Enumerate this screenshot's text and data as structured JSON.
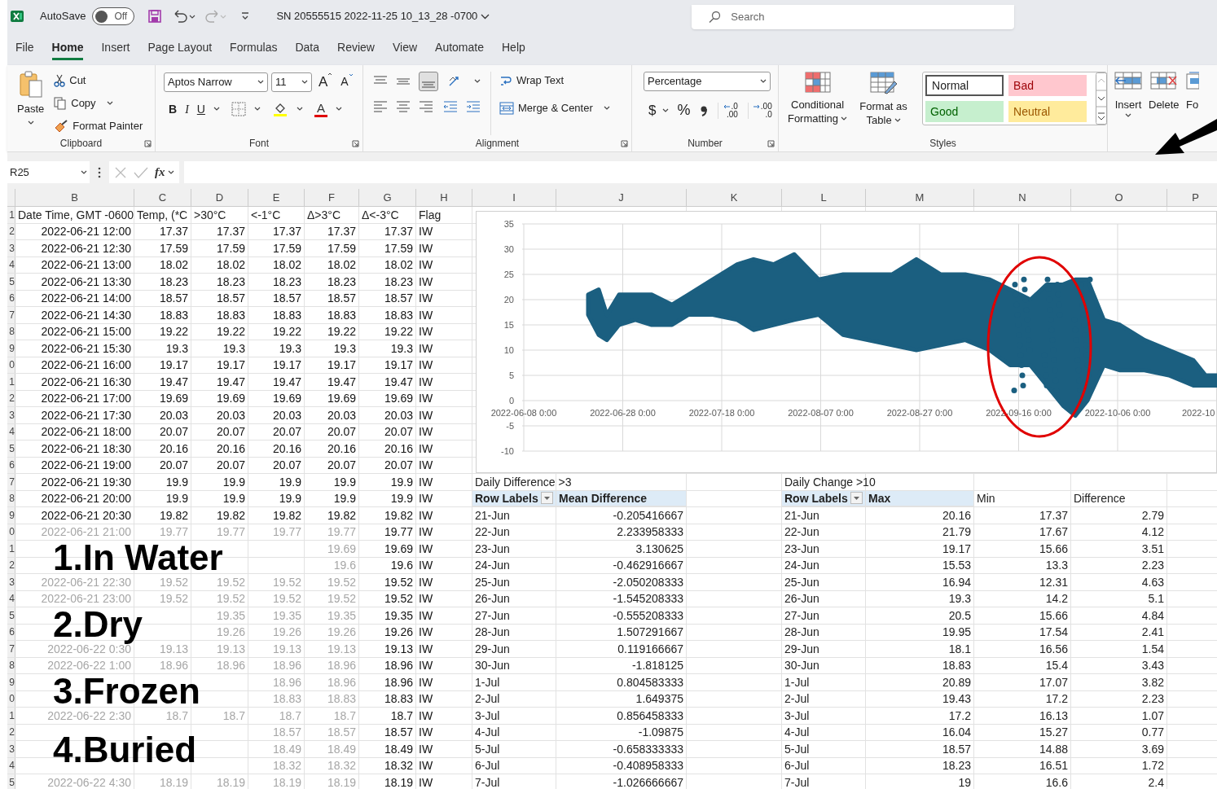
{
  "title_bar": {
    "autosave_label": "AutoSave",
    "autosave_toggle": {
      "on": false,
      "label": "Off"
    },
    "document_title": "SN 20555515 2022-11-25 10_13_28 -0700",
    "search": {
      "placeholder": "Search"
    }
  },
  "menu_tabs": [
    {
      "label": "File",
      "selected": false
    },
    {
      "label": "Home",
      "selected": true
    },
    {
      "label": "Insert",
      "selected": false
    },
    {
      "label": "Page Layout",
      "selected": false
    },
    {
      "label": "Formulas",
      "selected": false
    },
    {
      "label": "Data",
      "selected": false
    },
    {
      "label": "Review",
      "selected": false
    },
    {
      "label": "View",
      "selected": false
    },
    {
      "label": "Automate",
      "selected": false
    },
    {
      "label": "Help",
      "selected": false
    }
  ],
  "ribbon": {
    "clipboard": {
      "paste": "Paste",
      "cut": "Cut",
      "copy": "Copy",
      "format_painter": "Format Painter",
      "group_label": "Clipboard"
    },
    "font": {
      "font_name": "Aptos Narrow",
      "font_size": "11",
      "grow": "A",
      "shrink": "A",
      "bold": "B",
      "italic": "I",
      "underline": "U",
      "font_color": "A",
      "group_label": "Font"
    },
    "alignment": {
      "wrap_text": "Wrap Text",
      "merge_center": "Merge & Center",
      "group_label": "Alignment"
    },
    "number": {
      "format": "Percentage",
      "currency": "$",
      "percent": "%",
      "increase_decimal": [
        ".0",
        ".00"
      ],
      "decrease_decimal": [
        ".00",
        ".0"
      ],
      "group_label": "Number"
    },
    "styles": {
      "conditional_formatting": [
        "Conditional",
        "Formatting"
      ],
      "format_as_table": [
        "Format as",
        "Table"
      ],
      "cell_styles": [
        {
          "label": "Normal",
          "kind": "normal"
        },
        {
          "label": "Bad",
          "kind": "bad"
        },
        {
          "label": "Good",
          "kind": "good"
        },
        {
          "label": "Neutral",
          "kind": "neutral"
        }
      ],
      "group_label": "Styles"
    },
    "cells": {
      "insert": "Insert",
      "delete": "Delete",
      "format": "Fo"
    }
  },
  "formula_bar": {
    "name_box": "R25",
    "fx": "fx"
  },
  "sheet": {
    "column_headers": [
      "B",
      "C",
      "D",
      "E",
      "F",
      "G",
      "H",
      "I",
      "J",
      "K",
      "L",
      "M",
      "N",
      "O",
      "P"
    ],
    "header_row": {
      "row_number": "1",
      "cells": {
        "b": "Date Time, GMT -0600",
        "c": "Temp, (*C",
        "d": ">30°C",
        "e": "<-1°C",
        "f": "Δ>3°C",
        "g": "Δ<-3°C",
        "h": "Flag"
      }
    },
    "rows": [
      {
        "row_number": "2",
        "greyed": false,
        "cells": {
          "b": "2022-06-21 12:00",
          "c": "17.37",
          "d": "17.37",
          "e": "17.37",
          "f": "17.37",
          "g": "17.37",
          "h": "IW"
        }
      },
      {
        "row_number": "3",
        "greyed": false,
        "cells": {
          "b": "2022-06-21 12:30",
          "c": "17.59",
          "d": "17.59",
          "e": "17.59",
          "f": "17.59",
          "g": "17.59",
          "h": "IW"
        }
      },
      {
        "row_number": "4",
        "greyed": false,
        "cells": {
          "b": "2022-06-21 13:00",
          "c": "18.02",
          "d": "18.02",
          "e": "18.02",
          "f": "18.02",
          "g": "18.02",
          "h": "IW"
        }
      },
      {
        "row_number": "5",
        "greyed": false,
        "cells": {
          "b": "2022-06-21 13:30",
          "c": "18.23",
          "d": "18.23",
          "e": "18.23",
          "f": "18.23",
          "g": "18.23",
          "h": "IW"
        }
      },
      {
        "row_number": "6",
        "greyed": false,
        "cells": {
          "b": "2022-06-21 14:00",
          "c": "18.57",
          "d": "18.57",
          "e": "18.57",
          "f": "18.57",
          "g": "18.57",
          "h": "IW"
        }
      },
      {
        "row_number": "7",
        "greyed": false,
        "cells": {
          "b": "2022-06-21 14:30",
          "c": "18.83",
          "d": "18.83",
          "e": "18.83",
          "f": "18.83",
          "g": "18.83",
          "h": "IW"
        }
      },
      {
        "row_number": "8",
        "greyed": false,
        "cells": {
          "b": "2022-06-21 15:00",
          "c": "19.22",
          "d": "19.22",
          "e": "19.22",
          "f": "19.22",
          "g": "19.22",
          "h": "IW"
        }
      },
      {
        "row_number": "9",
        "greyed": false,
        "cells": {
          "b": "2022-06-21 15:30",
          "c": "19.3",
          "d": "19.3",
          "e": "19.3",
          "f": "19.3",
          "g": "19.3",
          "h": "IW"
        }
      },
      {
        "row_number": "0",
        "greyed": false,
        "cells": {
          "b": "2022-06-21 16:00",
          "c": "19.17",
          "d": "19.17",
          "e": "19.17",
          "f": "19.17",
          "g": "19.17",
          "h": "IW"
        }
      },
      {
        "row_number": "1",
        "greyed": false,
        "cells": {
          "b": "2022-06-21 16:30",
          "c": "19.47",
          "d": "19.47",
          "e": "19.47",
          "f": "19.47",
          "g": "19.47",
          "h": "IW"
        }
      },
      {
        "row_number": "2",
        "greyed": false,
        "cells": {
          "b": "2022-06-21 17:00",
          "c": "19.69",
          "d": "19.69",
          "e": "19.69",
          "f": "19.69",
          "g": "19.69",
          "h": "IW"
        }
      },
      {
        "row_number": "3",
        "greyed": false,
        "cells": {
          "b": "2022-06-21 17:30",
          "c": "20.03",
          "d": "20.03",
          "e": "20.03",
          "f": "20.03",
          "g": "20.03",
          "h": "IW"
        }
      },
      {
        "row_number": "4",
        "greyed": false,
        "cells": {
          "b": "2022-06-21 18:00",
          "c": "20.07",
          "d": "20.07",
          "e": "20.07",
          "f": "20.07",
          "g": "20.07",
          "h": "IW"
        }
      },
      {
        "row_number": "5",
        "greyed": false,
        "cells": {
          "b": "2022-06-21 18:30",
          "c": "20.16",
          "d": "20.16",
          "e": "20.16",
          "f": "20.16",
          "g": "20.16",
          "h": "IW"
        }
      },
      {
        "row_number": "6",
        "greyed": false,
        "cells": {
          "b": "2022-06-21 19:00",
          "c": "20.07",
          "d": "20.07",
          "e": "20.07",
          "f": "20.07",
          "g": "20.07",
          "h": "IW"
        }
      },
      {
        "row_number": "7",
        "greyed": false,
        "cells": {
          "b": "2022-06-21 19:30",
          "c": "19.9",
          "d": "19.9",
          "e": "19.9",
          "f": "19.9",
          "g": "19.9",
          "h": "IW"
        }
      },
      {
        "row_number": "8",
        "greyed": false,
        "cells": {
          "b": "2022-06-21 20:00",
          "c": "19.9",
          "d": "19.9",
          "e": "19.9",
          "f": "19.9",
          "g": "19.9",
          "h": "IW"
        }
      },
      {
        "row_number": "9",
        "greyed": false,
        "cells": {
          "b": "2022-06-21 20:30",
          "c": "19.82",
          "d": "19.82",
          "e": "19.82",
          "f": "19.82",
          "g": "19.82",
          "h": "IW"
        }
      },
      {
        "row_number": "0",
        "greyed": true,
        "cells": {
          "b": "2022-06-21 21:00",
          "c": "19.77",
          "d": "19.77",
          "e": "19.77",
          "f": "19.77",
          "g": "19.77",
          "h": "IW"
        }
      },
      {
        "row_number": "1",
        "greyed": true,
        "cells": {
          "f": "19.69",
          "g": "19.69",
          "h": "IW"
        }
      },
      {
        "row_number": "2",
        "greyed": true,
        "cells": {
          "f": "19.6",
          "g": "19.6",
          "h": "IW"
        }
      },
      {
        "row_number": "3",
        "greyed": true,
        "cells": {
          "b": "2022-06-21 22:30",
          "c": "19.52",
          "d": "19.52",
          "e": "19.52",
          "f": "19.52",
          "g": "19.52",
          "h": "IW"
        }
      },
      {
        "row_number": "4",
        "greyed": true,
        "cells": {
          "b": "2022-06-21 23:00",
          "c": "19.52",
          "d": "19.52",
          "e": "19.52",
          "f": "19.52",
          "g": "19.52",
          "h": "IW"
        }
      },
      {
        "row_number": "5",
        "greyed": true,
        "cells": {
          "d": "19.35",
          "e": "19.35",
          "f": "19.35",
          "g": "19.35",
          "h": "IW"
        }
      },
      {
        "row_number": "6",
        "greyed": true,
        "cells": {
          "d": "19.26",
          "e": "19.26",
          "f": "19.26",
          "g": "19.26",
          "h": "IW"
        }
      },
      {
        "row_number": "7",
        "greyed": true,
        "cells": {
          "b": "2022-06-22 0:30",
          "c": "19.13",
          "d": "19.13",
          "e": "19.13",
          "f": "19.13",
          "g": "19.13",
          "h": "IW"
        }
      },
      {
        "row_number": "8",
        "greyed": true,
        "cells": {
          "b": "2022-06-22 1:00",
          "c": "18.96",
          "d": "18.96",
          "e": "18.96",
          "f": "18.96",
          "g": "18.96",
          "h": "IW"
        }
      },
      {
        "row_number": "9",
        "greyed": true,
        "cells": {
          "e": "18.96",
          "f": "18.96",
          "g": "18.96",
          "h": "IW"
        }
      },
      {
        "row_number": "0",
        "greyed": true,
        "cells": {
          "e": "18.83",
          "f": "18.83",
          "g": "18.83",
          "h": "IW"
        }
      },
      {
        "row_number": "1",
        "greyed": true,
        "cells": {
          "b": "2022-06-22 2:30",
          "c": "18.7",
          "d": "18.7",
          "e": "18.7",
          "f": "18.7",
          "g": "18.7",
          "h": "IW"
        }
      },
      {
        "row_number": "2",
        "greyed": true,
        "cells": {
          "e": "18.57",
          "f": "18.57",
          "g": "18.57",
          "h": "IW"
        }
      },
      {
        "row_number": "3",
        "greyed": true,
        "cells": {
          "e": "18.49",
          "f": "18.49",
          "g": "18.49",
          "h": "IW"
        }
      },
      {
        "row_number": "4",
        "greyed": true,
        "cells": {
          "e": "18.32",
          "f": "18.32",
          "g": "18.32",
          "h": "IW"
        }
      },
      {
        "row_number": "5",
        "greyed": true,
        "cells": {
          "b": "2022-06-22 4:30",
          "c": "18.19",
          "d": "18.19",
          "e": "18.19",
          "f": "18.19",
          "g": "18.19",
          "h": "IW"
        }
      }
    ],
    "overlay_labels": [
      "1.In Water",
      "2.Dry",
      "3.Frozen",
      "4.Buried"
    ]
  },
  "chart": {
    "y_ticks": [
      "35",
      "30",
      "25",
      "20",
      "15",
      "10",
      "5",
      "0",
      "-5",
      "-10"
    ],
    "x_ticks": [
      "2022-06-08 0:00",
      "2022-06-28 0:00",
      "2022-07-18 0:00",
      "2022-08-07 0:00",
      "2022-08-27 0:00",
      "2022-09-16 0:00",
      "2022-10-06 0:00",
      "2022-10"
    ]
  },
  "pivot_mean": {
    "title": "Daily Difference >3",
    "headers": [
      "Row Labels",
      "Mean Difference"
    ],
    "rows": [
      [
        "21-Jun",
        "-0.205416667"
      ],
      [
        "22-Jun",
        "2.233958333"
      ],
      [
        "23-Jun",
        "3.130625"
      ],
      [
        "24-Jun",
        "-0.462916667"
      ],
      [
        "25-Jun",
        "-2.050208333"
      ],
      [
        "26-Jun",
        "-1.545208333"
      ],
      [
        "27-Jun",
        "-0.555208333"
      ],
      [
        "28-Jun",
        "1.507291667"
      ],
      [
        "29-Jun",
        "0.119166667"
      ],
      [
        "30-Jun",
        "-1.818125"
      ],
      [
        "1-Jul",
        "0.804583333"
      ],
      [
        "2-Jul",
        "1.649375"
      ],
      [
        "3-Jul",
        "0.856458333"
      ],
      [
        "4-Jul",
        "-1.09875"
      ],
      [
        "5-Jul",
        "-0.658333333"
      ],
      [
        "6-Jul",
        "-0.408958333"
      ],
      [
        "7-Jul",
        "-1.026666667"
      ]
    ]
  },
  "pivot_change": {
    "title": "Daily Change >10",
    "headers": [
      "Row Labels",
      "Max"
    ],
    "extra_headers": [
      "Min",
      "Difference"
    ],
    "rows": [
      [
        "21-Jun",
        "20.16",
        "17.37",
        "2.79"
      ],
      [
        "22-Jun",
        "21.79",
        "17.67",
        "4.12"
      ],
      [
        "23-Jun",
        "19.17",
        "15.66",
        "3.51"
      ],
      [
        "24-Jun",
        "15.53",
        "13.3",
        "2.23"
      ],
      [
        "25-Jun",
        "16.94",
        "12.31",
        "4.63"
      ],
      [
        "26-Jun",
        "19.3",
        "14.2",
        "5.1"
      ],
      [
        "27-Jun",
        "20.5",
        "15.66",
        "4.84"
      ],
      [
        "28-Jun",
        "19.95",
        "17.54",
        "2.41"
      ],
      [
        "29-Jun",
        "18.1",
        "16.56",
        "1.54"
      ],
      [
        "30-Jun",
        "18.83",
        "15.4",
        "3.43"
      ],
      [
        "1-Jul",
        "20.89",
        "17.07",
        "3.82"
      ],
      [
        "2-Jul",
        "19.43",
        "17.2",
        "2.23"
      ],
      [
        "3-Jul",
        "17.2",
        "16.13",
        "1.07"
      ],
      [
        "4-Jul",
        "16.04",
        "15.27",
        "0.77"
      ],
      [
        "5-Jul",
        "18.57",
        "14.88",
        "3.69"
      ],
      [
        "6-Jul",
        "18.23",
        "16.51",
        "1.72"
      ],
      [
        "7-Jul",
        "19",
        "16.6",
        "2.4"
      ]
    ]
  }
}
